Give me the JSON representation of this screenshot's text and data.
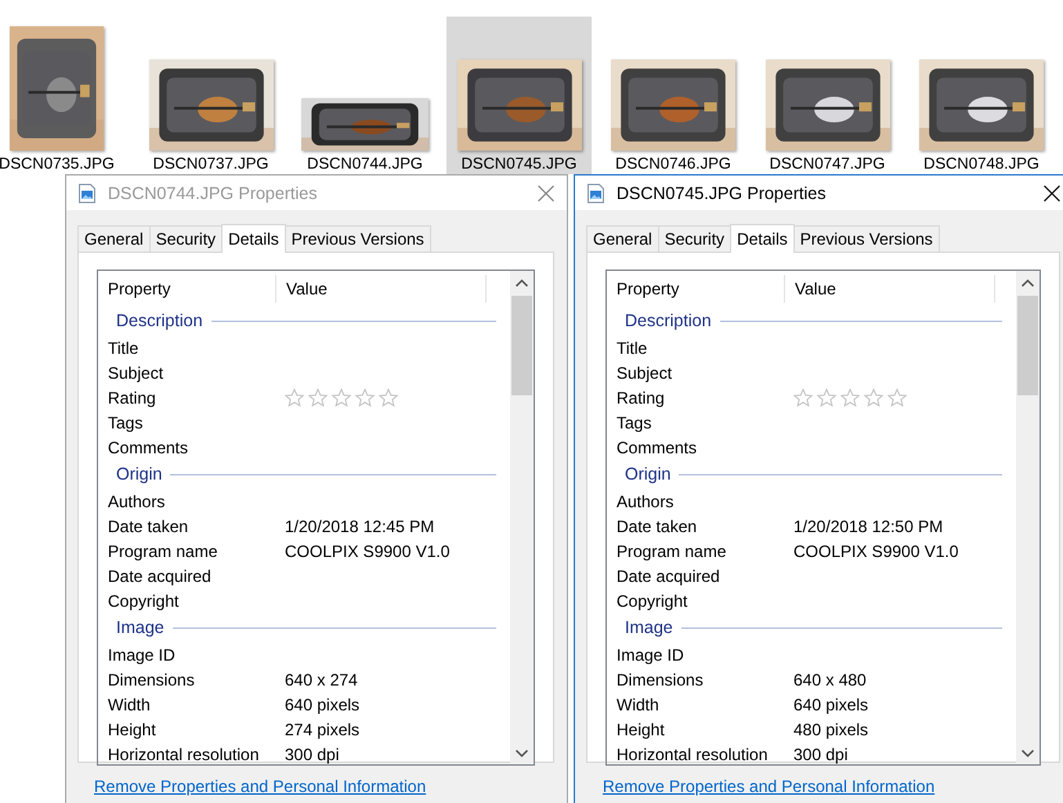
{
  "thumbnails": [
    {
      "label": "DSCN0735.JPG",
      "selected": false,
      "kind": "picture"
    },
    {
      "label": "DSCN0737.JPG",
      "selected": false,
      "kind": "picture"
    },
    {
      "label": "DSCN0744.JPG",
      "selected": false,
      "kind": "picture"
    },
    {
      "label": "DSCN0745.JPG",
      "selected": true,
      "kind": "picture"
    },
    {
      "label": "DSCN0746.JPG",
      "selected": false,
      "kind": "picture"
    },
    {
      "label": "DSCN0747.JPG",
      "selected": false,
      "kind": "picture"
    },
    {
      "label": "DSCN0748.JPG",
      "selected": false,
      "kind": "picture"
    }
  ],
  "dialogs": [
    {
      "title": "DSCN0744.JPG Properties",
      "active": false,
      "tabs": [
        {
          "label": "General",
          "selected": false
        },
        {
          "label": "Security",
          "selected": false
        },
        {
          "label": "Details",
          "selected": true
        },
        {
          "label": "Previous Versions",
          "selected": false
        }
      ],
      "columns": [
        "Property",
        "Value"
      ],
      "groups": [
        {
          "name": "Description",
          "rows": [
            {
              "kind": "text",
              "property": "Title"
            },
            {
              "kind": "text",
              "property": "Subject"
            },
            {
              "kind": "rating",
              "property": "Rating",
              "stars": 0
            },
            {
              "kind": "text",
              "property": "Tags"
            },
            {
              "kind": "text",
              "property": "Comments"
            }
          ]
        },
        {
          "name": "Origin",
          "rows": [
            {
              "kind": "text",
              "property": "Authors"
            },
            {
              "kind": "text",
              "property": "Date taken",
              "value": "1/20/2018 12:45 PM"
            },
            {
              "kind": "text",
              "property": "Program name",
              "value": "COOLPIX S9900  V1.0"
            },
            {
              "kind": "text",
              "property": "Date acquired"
            },
            {
              "kind": "text",
              "property": "Copyright"
            }
          ]
        },
        {
          "name": "Image",
          "rows": [
            {
              "kind": "text",
              "property": "Image ID"
            },
            {
              "kind": "text",
              "property": "Dimensions",
              "value": "640 x 274"
            },
            {
              "kind": "text",
              "property": "Width",
              "value": "640 pixels"
            },
            {
              "kind": "text",
              "property": "Height",
              "value": "274 pixels"
            },
            {
              "kind": "text",
              "property": "Horizontal resolution",
              "value": "300 dpi"
            }
          ]
        }
      ],
      "link": "Remove Properties and Personal Information"
    },
    {
      "title": "DSCN0745.JPG Properties",
      "active": true,
      "tabs": [
        {
          "label": "General",
          "selected": false
        },
        {
          "label": "Security",
          "selected": false
        },
        {
          "label": "Details",
          "selected": true
        },
        {
          "label": "Previous Versions",
          "selected": false
        }
      ],
      "columns": [
        "Property",
        "Value"
      ],
      "groups": [
        {
          "name": "Description",
          "rows": [
            {
              "kind": "text",
              "property": "Title"
            },
            {
              "kind": "text",
              "property": "Subject"
            },
            {
              "kind": "rating",
              "property": "Rating",
              "stars": 0
            },
            {
              "kind": "text",
              "property": "Tags"
            },
            {
              "kind": "text",
              "property": "Comments"
            }
          ]
        },
        {
          "name": "Origin",
          "rows": [
            {
              "kind": "text",
              "property": "Authors"
            },
            {
              "kind": "text",
              "property": "Date taken",
              "value": "1/20/2018 12:50 PM"
            },
            {
              "kind": "text",
              "property": "Program name",
              "value": "COOLPIX S9900  V1.0"
            },
            {
              "kind": "text",
              "property": "Date acquired"
            },
            {
              "kind": "text",
              "property": "Copyright"
            }
          ]
        },
        {
          "name": "Image",
          "rows": [
            {
              "kind": "text",
              "property": "Image ID"
            },
            {
              "kind": "text",
              "property": "Dimensions",
              "value": "640 x 480"
            },
            {
              "kind": "text",
              "property": "Width",
              "value": "640 pixels"
            },
            {
              "kind": "text",
              "property": "Height",
              "value": "480 pixels"
            },
            {
              "kind": "text",
              "property": "Horizontal resolution",
              "value": "300 dpi"
            }
          ]
        }
      ],
      "link": "Remove Properties and Personal Information"
    }
  ]
}
